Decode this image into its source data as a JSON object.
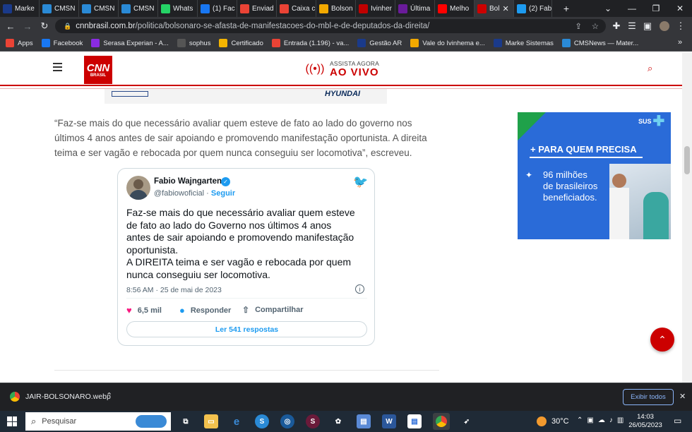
{
  "tabs": [
    {
      "label": "Marke",
      "icon": "marke-icon",
      "color": "#1a3a8a"
    },
    {
      "label": "CMSN",
      "icon": "cmsnews-icon",
      "color": "#2a8ad6"
    },
    {
      "label": "CMSN",
      "icon": "cmsnews-icon",
      "color": "#2a8ad6"
    },
    {
      "label": "CMSN",
      "icon": "cmsnews-icon",
      "color": "#2a8ad6"
    },
    {
      "label": "Whats",
      "icon": "whatsapp-icon",
      "color": "#25d366"
    },
    {
      "label": "(1) Fac",
      "icon": "facebook-icon",
      "color": "#1877f2"
    },
    {
      "label": "Enviad",
      "icon": "gmail-icon",
      "color": "#ea4335"
    },
    {
      "label": "Caixa c",
      "icon": "gmail-icon",
      "color": "#ea4335"
    },
    {
      "label": "Bolson",
      "icon": "news-icon",
      "color": "#f2a900"
    },
    {
      "label": "Ivinher",
      "icon": "site-icon",
      "color": "#c00000"
    },
    {
      "label": "Última",
      "icon": "site-icon",
      "color": "#6a1b9a"
    },
    {
      "label": "Melho",
      "icon": "youtube-icon",
      "color": "#ff0000"
    },
    {
      "label": "Bol",
      "icon": "cnn-icon",
      "color": "#cc0000",
      "active": true
    },
    {
      "label": "(2) Fab",
      "icon": "twitter-icon",
      "color": "#1d9bf0"
    }
  ],
  "address": {
    "domain": "cnnbrasil.com.br",
    "path": "/politica/bolsonaro-se-afasta-de-manifestacoes-do-mbl-e-de-deputados-da-direita/"
  },
  "bookmarks": [
    {
      "label": "Apps",
      "color": "#ea4335"
    },
    {
      "label": "Facebook",
      "color": "#1877f2"
    },
    {
      "label": "Serasa Experian - A...",
      "color": "#8a2be2"
    },
    {
      "label": "sophus",
      "color": "#555555"
    },
    {
      "label": "Certificado",
      "color": "#f4b400"
    },
    {
      "label": "Entrada (1.196) - va...",
      "color": "#ea4335"
    },
    {
      "label": "Gestão AR",
      "color": "#1a3a8a"
    },
    {
      "label": "Vale do Ivinhema e...",
      "color": "#f2a900"
    },
    {
      "label": "Marke Sistemas",
      "color": "#1a3a8a"
    },
    {
      "label": "CMSNews — Mater...",
      "color": "#2a8ad6"
    }
  ],
  "header": {
    "logo_top": "CNN",
    "logo_bottom": "BRASIL",
    "live_top": "ASSISTA AGORA",
    "live_bottom": "AO VIVO"
  },
  "ad_top": {
    "brand": "HYUNDAI"
  },
  "article": {
    "quote": "“Faz-se mais do que necessário avaliar quem esteve de fato ao lado do governo nos últimos 4 anos antes de sair apoiando e promovendo manifestação oportunista. A direita teima e ser vagão e rebocada por quem nunca conseguiu ser locomotiva”, escreveu."
  },
  "tweet": {
    "name": "Fabio Wajngarten",
    "handle": "@fabiowoficial",
    "sep": "·",
    "follow": "Seguir",
    "text_lines": [
      "Faz-se mais do que necessário avaliar quem esteve",
      "de fato ao lado do Governo nos últimos 4 anos",
      "antes de sair apoiando e promovendo manifestação",
      "oportunista.",
      "A DIREITA teima e ser vagão e rebocada por quem",
      "nunca conseguiu ser locomotiva."
    ],
    "time": "8:56 AM · 25 de mai de 2023",
    "likes": "6,5 mil",
    "reply": "Responder",
    "share": "Compartilhar",
    "read_replies": "Ler 541 respostas"
  },
  "side_ad": {
    "sus": "SUS",
    "headline": "+ PARA QUEM PRECISA",
    "line1": "96 milhões",
    "line2": "de brasileiros",
    "line3": "beneficiados."
  },
  "download": {
    "file": "JAIR-BOLSONARO.webp",
    "show_all": "Exibir todos"
  },
  "taskbar": {
    "search": "Pesquisar",
    "weather": "30°C",
    "time": "14:03",
    "date": "26/05/2023"
  }
}
